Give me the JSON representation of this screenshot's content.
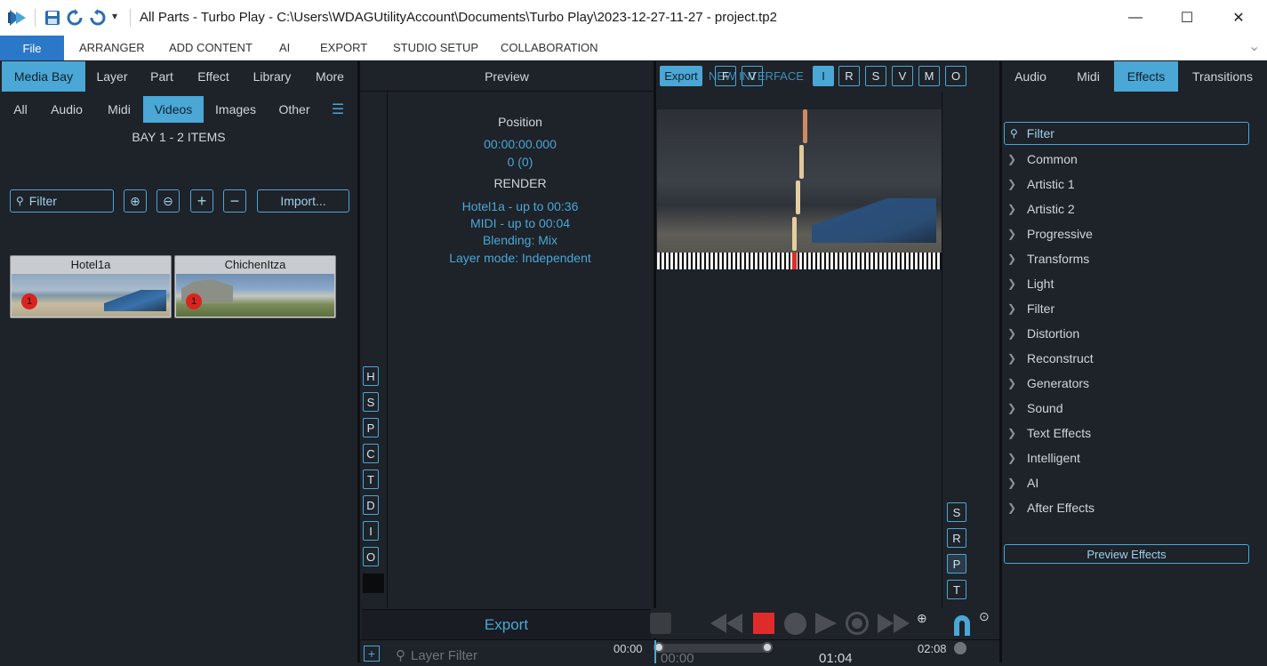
{
  "window": {
    "title": "All Parts - Turbo Play - C:\\Users\\WDAGUtilityAccount\\Documents\\Turbo Play\\2023-12-27-11-27 - project.tp2",
    "dropdown_glyph": "▾",
    "controls": {
      "minimize": "—",
      "maximize": "☐",
      "close": "✕"
    }
  },
  "menu": {
    "file": "File",
    "items": [
      "ARRANGER",
      "ADD CONTENT",
      "AI",
      "EXPORT",
      "STUDIO SETUP",
      "COLLABORATION"
    ],
    "collapse_glyph": "⌄"
  },
  "left_panel": {
    "tabs": [
      "Media Bay",
      "Layer",
      "Part",
      "Effect",
      "Library",
      "More"
    ],
    "active_tab": "Media Bay",
    "subtabs": [
      "All",
      "Audio",
      "Midi",
      "Videos",
      "Images",
      "Other"
    ],
    "active_subtab": "Videos",
    "menu_glyph": "☰",
    "bay_label": "BAY 1 - 2 ITEMS",
    "filter_placeholder": "Filter",
    "zoom_in": "⊕",
    "zoom_out": "⊖",
    "add": "+",
    "remove": "−",
    "import_label": "Import...",
    "items": [
      {
        "name": "Hotel1a",
        "badge": "1"
      },
      {
        "name": "ChichenItza",
        "badge": "1"
      }
    ]
  },
  "preview": {
    "header": "Preview",
    "position_label": "Position",
    "position_time": "00:00:00.000",
    "position_frame": "0 (0)",
    "render_label": "RENDER",
    "render_lines": [
      "Hotel1a - up to 00:36",
      "MIDI - up to 00:04",
      "Blending: Mix",
      "Layer mode: Independent"
    ],
    "side_buttons": [
      "H",
      "S",
      "P",
      "C",
      "T",
      "D",
      "I",
      "O"
    ],
    "export_label": "Export"
  },
  "player": {
    "top_export": "Export",
    "top_f": "F",
    "top_v": "V",
    "top_overlay": "NEW INTERFACE",
    "mode_buttons": [
      "I",
      "R",
      "S",
      "V",
      "M",
      "O"
    ],
    "active_mode": "I",
    "right_buttons": [
      "S",
      "R",
      "P",
      "T"
    ],
    "transport": [
      "rewind",
      "stop",
      "circle",
      "play",
      "record",
      "fast-forward"
    ]
  },
  "timeline": {
    "layer_filter_placeholder": "Layer Filter",
    "time_start": "00:00",
    "time_end": "02:08",
    "ruler_0": "00:00",
    "ruler_1": "01:04"
  },
  "right_panel": {
    "tabs": [
      "Audio",
      "Midi",
      "Effects",
      "Transitions"
    ],
    "active_tab": "Effects",
    "filter_placeholder": "Filter",
    "categories": [
      "Common",
      "Artistic 1",
      "Artistic 2",
      "Progressive",
      "Transforms",
      "Light",
      "Filter",
      "Distortion",
      "Reconstruct",
      "Generators",
      "Sound",
      "Text Effects",
      "Intelligent",
      "AI",
      "After Effects"
    ],
    "preview_effects_label": "Preview Effects"
  },
  "colors": {
    "accent": "#4aa7d6",
    "background": "#1e2229",
    "record_red": "#e02b2b",
    "file_blue": "#2b78c8"
  }
}
